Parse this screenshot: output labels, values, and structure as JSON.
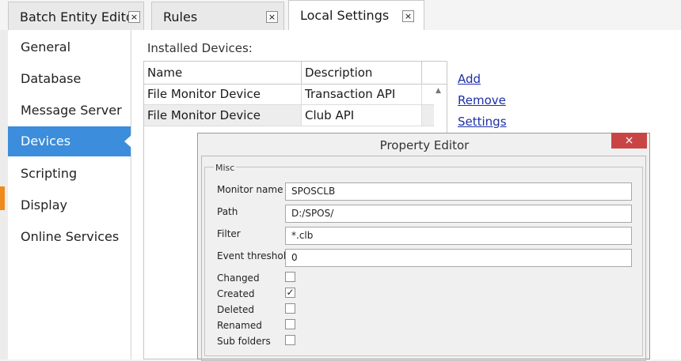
{
  "tabs": [
    {
      "label": "Batch Entity Editor",
      "close": "×"
    },
    {
      "label": "Rules",
      "close": "×"
    },
    {
      "label": "Local Settings",
      "close": "×"
    }
  ],
  "sidebar": {
    "items": [
      "General",
      "Database",
      "Message Server",
      "Devices",
      "Scripting",
      "Display",
      "Online Services"
    ],
    "active": "Devices"
  },
  "devices": {
    "installed_label": "Installed Devices:",
    "columns": [
      "Name",
      "Description"
    ],
    "rows": [
      {
        "name": "File Monitor Device",
        "description": "Transaction API"
      },
      {
        "name": "File Monitor Device",
        "description": "Club API"
      }
    ],
    "scroll_up": "▲",
    "links": {
      "add": "Add",
      "remove": "Remove",
      "settings": "Settings"
    }
  },
  "property_editor": {
    "title": "Property Editor",
    "close": "×",
    "group": "Misc",
    "fields": {
      "monitor_name": {
        "label": "Monitor name",
        "value": "SPOSCLB"
      },
      "path": {
        "label": "Path",
        "value": "D:/SPOS/"
      },
      "filter": {
        "label": "Filter",
        "value": "*.clb"
      },
      "event_threshold": {
        "label": "Event threshold",
        "value": "0"
      }
    },
    "checkboxes": [
      {
        "label": "Changed",
        "checked": false,
        "mark": ""
      },
      {
        "label": "Created",
        "checked": true,
        "mark": "✓"
      },
      {
        "label": "Deleted",
        "checked": false,
        "mark": ""
      },
      {
        "label": "Renamed",
        "checked": false,
        "mark": ""
      },
      {
        "label": "Sub folders",
        "checked": false,
        "mark": ""
      }
    ]
  },
  "colors": {
    "accent": "#3c8ddc",
    "close_button": "#c94545",
    "link": "#1e2fa8",
    "side_marker": "#ef8a1c"
  }
}
